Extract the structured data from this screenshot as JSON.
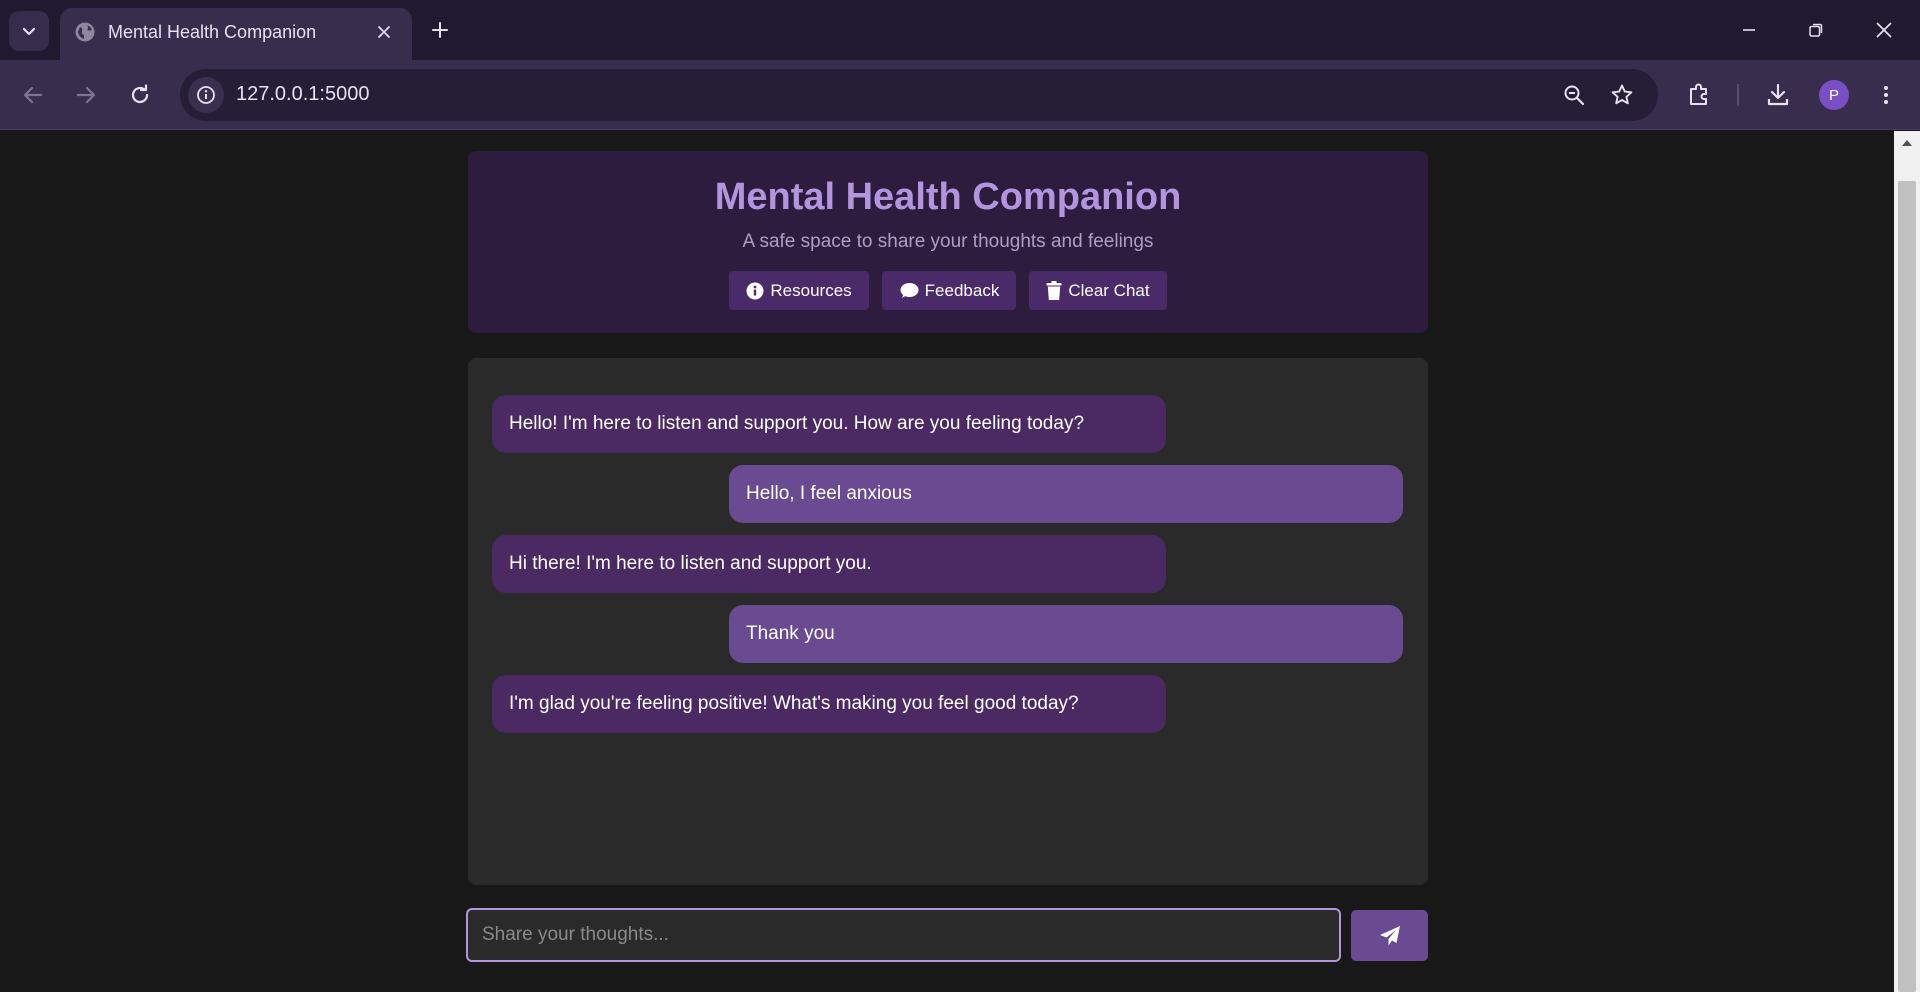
{
  "browser": {
    "tab_title": "Mental Health Companion",
    "url": "127.0.0.1:5000",
    "profile_initial": "P",
    "icons": [
      "tab-search-icon",
      "globe-icon",
      "close-icon",
      "plus-icon",
      "minimize-icon",
      "restore-icon",
      "window-close-icon",
      "back-arrow-icon",
      "forward-arrow-icon",
      "reload-icon",
      "info-icon",
      "zoom-out-icon",
      "star-icon",
      "extensions-icon",
      "download-icon",
      "more-vert-icon"
    ]
  },
  "header": {
    "title": "Mental Health Companion",
    "subtitle": "A safe space to share your thoughts and feelings",
    "buttons": [
      {
        "label": "Resources",
        "icon": "info-circle-icon"
      },
      {
        "label": "Feedback",
        "icon": "comment-icon"
      },
      {
        "label": "Clear Chat",
        "icon": "trash-icon"
      }
    ]
  },
  "chat": {
    "messages": [
      {
        "sender": "bot",
        "text": "Hello! I'm here to listen and support you. How are you feeling today?"
      },
      {
        "sender": "user",
        "text": "Hello, I feel anxious"
      },
      {
        "sender": "bot",
        "text": "Hi there! I'm here to listen and support you."
      },
      {
        "sender": "user",
        "text": "Thank you"
      },
      {
        "sender": "bot",
        "text": "I'm glad you're feeling positive! What's making you feel good today?"
      }
    ]
  },
  "composer": {
    "placeholder": "Share your thoughts...",
    "value": "",
    "send_icon": "paper-plane-icon"
  },
  "colors": {
    "accent": "#b295de",
    "bot_bubble": "#4b2963",
    "user_bubble": "#6a4a90",
    "header_bg": "#2d1c3d",
    "chat_bg": "#2a2a2a",
    "page_bg": "#181818"
  }
}
